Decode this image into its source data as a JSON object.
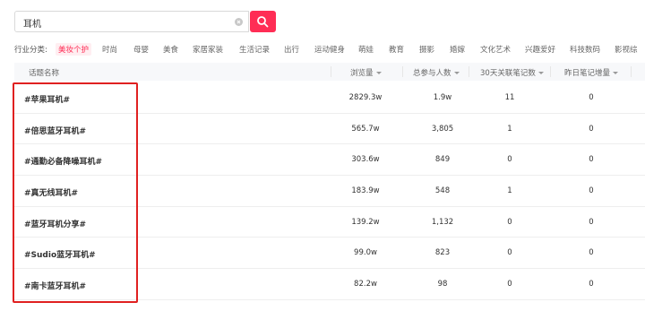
{
  "search": {
    "value": "耳机",
    "placeholder": ""
  },
  "categories": {
    "label": "行业分类:",
    "items": [
      "美妆个护",
      "时尚",
      "母婴",
      "美食",
      "家居家装",
      "生活记录",
      "出行",
      "运动健身",
      "萌娃",
      "教育",
      "摄影",
      "婚嫁",
      "文化艺术",
      "兴趣爱好",
      "科技数码",
      "影视综"
    ],
    "active_index": 0
  },
  "table": {
    "columns": [
      "话题名称",
      "浏览量",
      "总参与人数",
      "30天关联笔记数",
      "昨日笔记增量"
    ],
    "rows": [
      {
        "topic": "#苹果耳机#",
        "views": "2829.3w",
        "participants": "1.9w",
        "notes_30d": "11",
        "yesterday": "0"
      },
      {
        "topic": "#倍思蓝牙耳机#",
        "views": "565.7w",
        "participants": "3,805",
        "notes_30d": "1",
        "yesterday": "0"
      },
      {
        "topic": "#通勤必备降噪耳机#",
        "views": "303.6w",
        "participants": "849",
        "notes_30d": "0",
        "yesterday": "0"
      },
      {
        "topic": "#真无线耳机#",
        "views": "183.9w",
        "participants": "548",
        "notes_30d": "1",
        "yesterday": "0"
      },
      {
        "topic": "#蓝牙耳机分享#",
        "views": "139.2w",
        "participants": "1,132",
        "notes_30d": "0",
        "yesterday": "0"
      },
      {
        "topic": "#Sudio蓝牙耳机#",
        "views": "99.0w",
        "participants": "823",
        "notes_30d": "0",
        "yesterday": "0"
      },
      {
        "topic": "#南卡蓝牙耳机#",
        "views": "82.2w",
        "participants": "98",
        "notes_30d": "0",
        "yesterday": "0"
      }
    ]
  },
  "colors": {
    "accent": "#ff2d55",
    "highlight_border": "#e02020"
  },
  "icons": {
    "search": "search-icon",
    "clear": "clear-icon",
    "sort": "sort-caret-icon"
  }
}
